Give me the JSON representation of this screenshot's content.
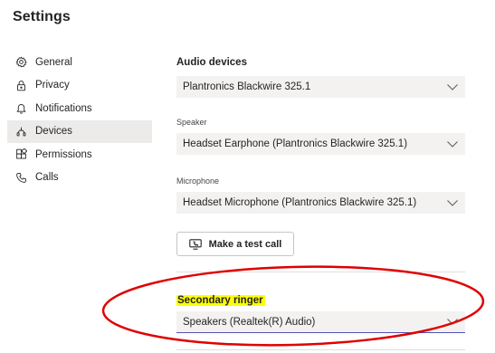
{
  "title": "Settings",
  "nav": {
    "items": [
      {
        "label": "General",
        "icon": "gear-icon"
      },
      {
        "label": "Privacy",
        "icon": "lock-icon"
      },
      {
        "label": "Notifications",
        "icon": "bell-icon"
      },
      {
        "label": "Devices",
        "icon": "devices-icon",
        "active": true
      },
      {
        "label": "Permissions",
        "icon": "apps-grid-icon"
      },
      {
        "label": "Calls",
        "icon": "phone-icon"
      }
    ]
  },
  "audio": {
    "section_title": "Audio devices",
    "audio_device_value": "Plantronics Blackwire 325.1",
    "speaker_label": "Speaker",
    "speaker_value": "Headset Earphone (Plantronics Blackwire 325.1)",
    "microphone_label": "Microphone",
    "microphone_value": "Headset Microphone (Plantronics Blackwire 325.1)",
    "test_call_label": "Make a test call"
  },
  "secondary": {
    "title": "Secondary ringer",
    "value": "Speakers (Realtek(R) Audio)"
  },
  "colors": {
    "accent": "#4f52b2",
    "annotation": "#e00000",
    "highlight": "#ffff00"
  }
}
